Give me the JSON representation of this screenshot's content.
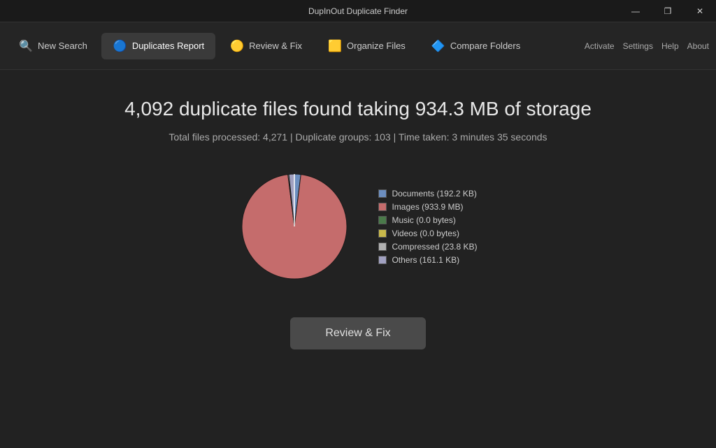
{
  "titleBar": {
    "title": "DupInOut Duplicate Finder",
    "minimize": "—",
    "maximize": "❐",
    "close": "✕"
  },
  "nav": {
    "tabs": [
      {
        "id": "new-search",
        "label": "New Search",
        "icon": "🔍",
        "active": false
      },
      {
        "id": "duplicates-report",
        "label": "Duplicates Report",
        "icon": "🔵",
        "active": true
      },
      {
        "id": "review-fix",
        "label": "Review & Fix",
        "icon": "🟡",
        "active": false
      },
      {
        "id": "organize-files",
        "label": "Organize Files",
        "icon": "🟨",
        "active": false
      },
      {
        "id": "compare-folders",
        "label": "Compare Folders",
        "icon": "🔷",
        "active": false
      }
    ],
    "rightLinks": [
      "Activate",
      "Settings",
      "Help",
      "About"
    ]
  },
  "main": {
    "headline": "4,092 duplicate files found taking 934.3 MB of storage",
    "subline": "Total files processed: 4,271  |  Duplicate groups: 103  |  Time taken: 3 minutes 35 seconds",
    "chart": {
      "segments": [
        {
          "label": "Documents",
          "value": 0.02,
          "color": "#6c8ebf"
        },
        {
          "label": "Images",
          "value": 0.97,
          "color": "#c56c6c"
        },
        {
          "label": "Music",
          "value": 0,
          "color": "#4a7a4a"
        },
        {
          "label": "Videos",
          "value": 0,
          "color": "#c8b84a"
        },
        {
          "label": "Compressed",
          "value": 0.003,
          "color": "#b0b0b0"
        },
        {
          "label": "Others",
          "value": 0.017,
          "color": "#a0a0c0"
        }
      ]
    },
    "legend": [
      {
        "label": "Documents (192.2 KB)",
        "color": "#6c8ebf"
      },
      {
        "label": "Images (933.9 MB)",
        "color": "#c56c6c"
      },
      {
        "label": "Music (0.0 bytes)",
        "color": "#4a7a4a"
      },
      {
        "label": "Videos (0.0 bytes)",
        "color": "#c8b84a"
      },
      {
        "label": "Compressed (23.8 KB)",
        "color": "#b0b0b0"
      },
      {
        "label": "Others (161.1 KB)",
        "color": "#a0a0c0"
      }
    ],
    "reviewButton": "Review & Fix"
  }
}
